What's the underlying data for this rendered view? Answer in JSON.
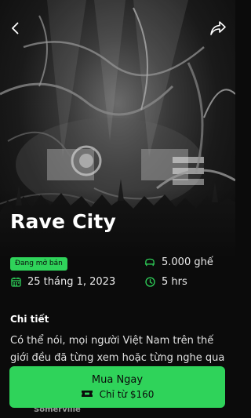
{
  "event": {
    "title": "Rave City",
    "status_badge": "Đang mở bán",
    "date": "25 tháng 1, 2023",
    "seats": "5.000 ghế",
    "duration": "5 hrs"
  },
  "details": {
    "heading": "Chi tiết",
    "description": "Có thể nói, mọi người Việt Nam trên thế giới đều đã từng xem hoặc từng nghe qua MV",
    "location": "Somerville"
  },
  "cta": {
    "label": "Mua Ngay",
    "price": "Chỉ từ $160"
  },
  "icons": {
    "back": "chevron-left-icon",
    "share": "share-icon",
    "calendar": "calendar-icon",
    "seat": "seat-icon",
    "clock": "clock-icon",
    "ticket": "ticket-icon"
  },
  "colors": {
    "accent": "#2fd35a",
    "background": "#0b0b0b"
  }
}
